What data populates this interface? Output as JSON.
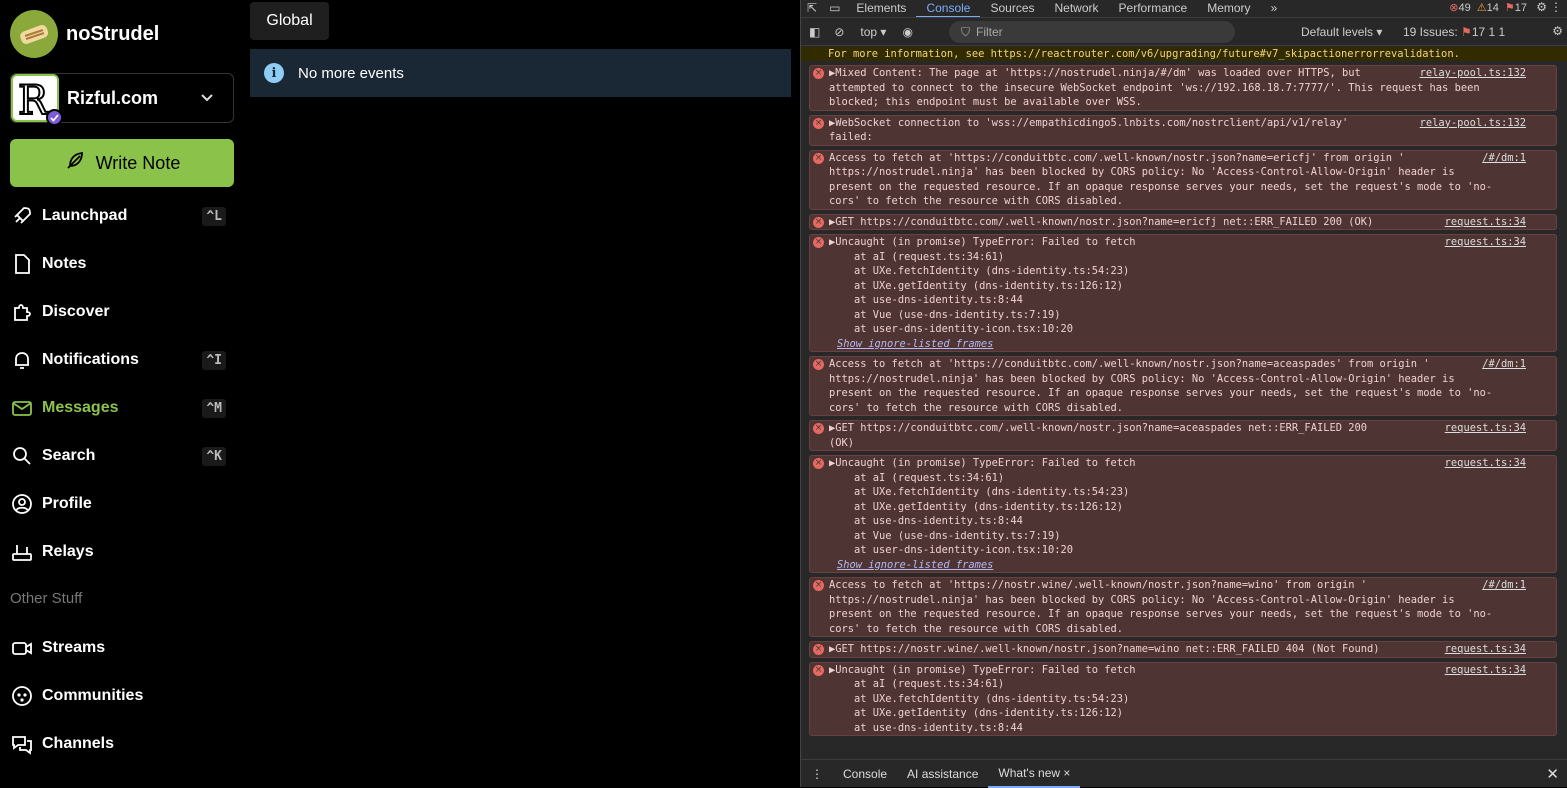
{
  "app": {
    "name": "noStrudel",
    "account_name": "Rizful.com",
    "write_note_label": "Write Note",
    "nav": [
      {
        "label": "Launchpad",
        "shortcut": "^L",
        "icon": "rocket-icon"
      },
      {
        "label": "Notes",
        "shortcut": "",
        "icon": "note-icon"
      },
      {
        "label": "Discover",
        "shortcut": "",
        "icon": "puzzle-icon"
      },
      {
        "label": "Notifications",
        "shortcut": "^I",
        "icon": "bell-icon"
      },
      {
        "label": "Messages",
        "shortcut": "^M",
        "icon": "mail-icon"
      },
      {
        "label": "Search",
        "shortcut": "^K",
        "icon": "search-icon"
      },
      {
        "label": "Profile",
        "shortcut": "",
        "icon": "user-circle-icon"
      },
      {
        "label": "Relays",
        "shortcut": "",
        "icon": "router-icon"
      }
    ],
    "other_section_label": "Other Stuff",
    "other_nav": [
      {
        "label": "Streams",
        "icon": "video-icon"
      },
      {
        "label": "Communities",
        "icon": "communities-icon"
      },
      {
        "label": "Channels",
        "icon": "channels-icon"
      }
    ],
    "main": {
      "tab_label": "Global",
      "alert_text": "No more events"
    },
    "colors": {
      "accent": "#8bc34a",
      "info": "#90cdf4"
    }
  },
  "devtools": {
    "tabs": [
      "Elements",
      "Console",
      "Sources",
      "Network",
      "Performance",
      "Memory"
    ],
    "active_tab": "Console",
    "counts": {
      "errors": "49",
      "warnings": "14",
      "issues_flag": "17"
    },
    "context": "top ▾",
    "filter_placeholder": "Filter",
    "levels": "Default levels ▾",
    "issues_label": "19 Issues:",
    "issues_counts": "17  1  1",
    "top_warning": "For more information, see https://reactrouter.com/v6/upgrading/future#v7_skipactionerrorrevalidation.",
    "messages": [
      {
        "lines": [
          "▶Mixed Content: The page at 'https://nostrudel.ninja/#/dm' was loaded over HTTPS, but",
          "attempted to connect to the insecure WebSocket endpoint 'ws://192.168.18.7:7777/'. This request has been",
          "blocked; this endpoint must be available over WSS."
        ],
        "source": "relay-pool.ts:132"
      },
      {
        "lines": [
          "▶WebSocket connection to 'wss://empathicdingo5.lnbits.com/nostrclient/api/v1/relay'",
          "failed:"
        ],
        "source": "relay-pool.ts:132"
      },
      {
        "lines": [
          "Access to fetch at 'https://conduitbtc.com/.well-known/nostr.json?name=ericfj' from origin '",
          "https://nostrudel.ninja' has been blocked by CORS policy: No 'Access-Control-Allow-Origin' header is",
          "present on the requested resource. If an opaque response serves your needs, set the request's mode to 'no-",
          "cors' to fetch the resource with CORS disabled."
        ],
        "source": "/#/dm:1"
      },
      {
        "lines": [
          "▶GET https://conduitbtc.com/.well-known/nostr.json?name=ericfj net::ERR_FAILED 200 (OK)"
        ],
        "source": "request.ts:34"
      },
      {
        "lines": [
          "▶Uncaught (in promise) TypeError: Failed to fetch",
          "    at aI (request.ts:34:61)",
          "    at UXe.fetchIdentity (dns-identity.ts:54:23)",
          "    at UXe.getIdentity (dns-identity.ts:126:12)",
          "    at use-dns-identity.ts:8:44",
          "    at Vue (use-dns-identity.ts:7:19)",
          "    at user-dns-identity-icon.tsx:10:20"
        ],
        "ignore": "Show ignore-listed frames",
        "source": "request.ts:34"
      },
      {
        "lines": [
          "Access to fetch at 'https://conduitbtc.com/.well-known/nostr.json?name=aceaspades' from origin '",
          "https://nostrudel.ninja' has been blocked by CORS policy: No 'Access-Control-Allow-Origin' header is",
          "present on the requested resource. If an opaque response serves your needs, set the request's mode to 'no-",
          "cors' to fetch the resource with CORS disabled."
        ],
        "source": "/#/dm:1"
      },
      {
        "lines": [
          "▶GET https://conduitbtc.com/.well-known/nostr.json?name=aceaspades net::ERR_FAILED 200",
          "(OK)"
        ],
        "source": "request.ts:34"
      },
      {
        "lines": [
          "▶Uncaught (in promise) TypeError: Failed to fetch",
          "    at aI (request.ts:34:61)",
          "    at UXe.fetchIdentity (dns-identity.ts:54:23)",
          "    at UXe.getIdentity (dns-identity.ts:126:12)",
          "    at use-dns-identity.ts:8:44",
          "    at Vue (use-dns-identity.ts:7:19)",
          "    at user-dns-identity-icon.tsx:10:20"
        ],
        "ignore": "Show ignore-listed frames",
        "source": "request.ts:34"
      },
      {
        "lines": [
          "Access to fetch at 'https://nostr.wine/.well-known/nostr.json?name=wino' from origin '",
          "https://nostrudel.ninja' has been blocked by CORS policy: No 'Access-Control-Allow-Origin' header is",
          "present on the requested resource. If an opaque response serves your needs, set the request's mode to 'no-",
          "cors' to fetch the resource with CORS disabled."
        ],
        "source": "/#/dm:1"
      },
      {
        "lines": [
          "▶GET https://nostr.wine/.well-known/nostr.json?name=wino net::ERR_FAILED 404 (Not Found)"
        ],
        "source": "request.ts:34"
      },
      {
        "lines": [
          "▶Uncaught (in promise) TypeError: Failed to fetch",
          "    at aI (request.ts:34:61)",
          "    at UXe.fetchIdentity (dns-identity.ts:54:23)",
          "    at UXe.getIdentity (dns-identity.ts:126:12)",
          "    at use-dns-identity.ts:8:44"
        ],
        "source": "request.ts:34"
      }
    ],
    "bottom_tabs": [
      "Console",
      "AI assistance",
      "What's new"
    ]
  }
}
